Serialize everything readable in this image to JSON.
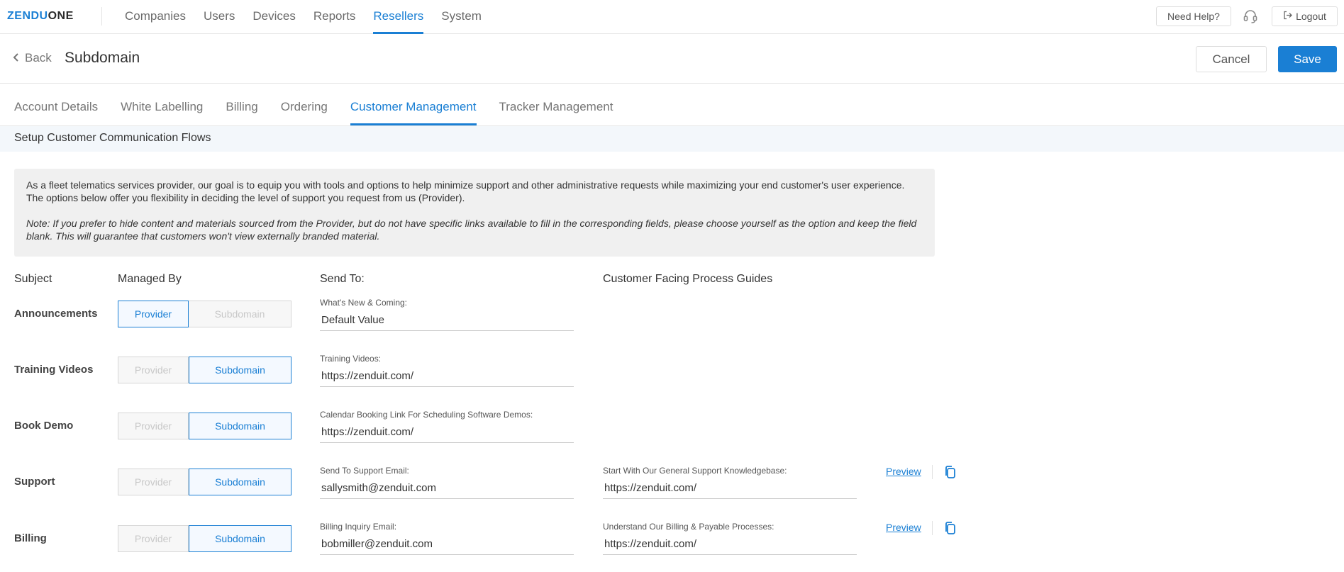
{
  "brand": {
    "logo_part1": "ZENDU",
    "logo_part2": "ONE",
    "accent_color": "#1a7fd4"
  },
  "topnav": {
    "items": [
      {
        "label": "Companies",
        "active": false
      },
      {
        "label": "Users",
        "active": false
      },
      {
        "label": "Devices",
        "active": false
      },
      {
        "label": "Reports",
        "active": false
      },
      {
        "label": "Resellers",
        "active": true
      },
      {
        "label": "System",
        "active": false
      }
    ],
    "help_label": "Need Help?",
    "support_icon": "headset-icon",
    "logout_label": "Logout",
    "logout_icon": "logout-icon"
  },
  "header": {
    "back_label": "Back",
    "back_icon": "chevron-left-icon",
    "title": "Subdomain",
    "cancel_label": "Cancel",
    "save_label": "Save"
  },
  "tabs": [
    {
      "label": "Account Details",
      "active": false
    },
    {
      "label": "White Labelling",
      "active": false
    },
    {
      "label": "Billing",
      "active": false
    },
    {
      "label": "Ordering",
      "active": false
    },
    {
      "label": "Customer Management",
      "active": true
    },
    {
      "label": "Tracker Management",
      "active": false
    }
  ],
  "section": {
    "title": "Setup Customer Communication Flows"
  },
  "info": {
    "paragraph": "As a fleet telematics services provider, our goal is to equip you with tools and options to help minimize support and other administrative requests while maximizing your end customer's user experience. The options below offer you flexibility in deciding the level of support you request from us (Provider).",
    "note": "Note: If you prefer to hide content and materials sourced from the Provider, but do not have specific links available to fill in the corresponding fields, please choose yourself as the option and keep the field blank. This will guarantee that customers won't view externally branded material."
  },
  "columns": {
    "subject": "Subject",
    "managed_by": "Managed By",
    "send_to": "Send To:",
    "guides": "Customer Facing Process Guides"
  },
  "toggle_labels": {
    "provider": "Provider",
    "subdomain": "Subdomain"
  },
  "rows": [
    {
      "subject": "Announcements",
      "managed_by": "Provider",
      "send_to_label": "What's New & Coming:",
      "send_to_value": "Default Value"
    },
    {
      "subject": "Training Videos",
      "managed_by": "Subdomain",
      "send_to_label": "Training Videos:",
      "send_to_value": "https://zenduit.com/"
    },
    {
      "subject": "Book Demo",
      "managed_by": "Subdomain",
      "send_to_label": "Calendar Booking Link For Scheduling Software Demos:",
      "send_to_value": "https://zenduit.com/"
    },
    {
      "subject": "Support",
      "managed_by": "Subdomain",
      "send_to_label": "Send To Support Email:",
      "send_to_value": "sallysmith@zenduit.com",
      "guide_label": "Start With Our General Support Knowledgebase:",
      "guide_value": "https://zenduit.com/",
      "preview_label": "Preview",
      "copy_icon": "copy-icon"
    },
    {
      "subject": "Billing",
      "managed_by": "Subdomain",
      "send_to_label": "Billing Inquiry Email:",
      "send_to_value": "bobmiller@zenduit.com",
      "guide_label": "Understand Our Billing & Payable Processes:",
      "guide_value": "https://zenduit.com/",
      "preview_label": "Preview",
      "copy_icon": "copy-icon"
    }
  ]
}
